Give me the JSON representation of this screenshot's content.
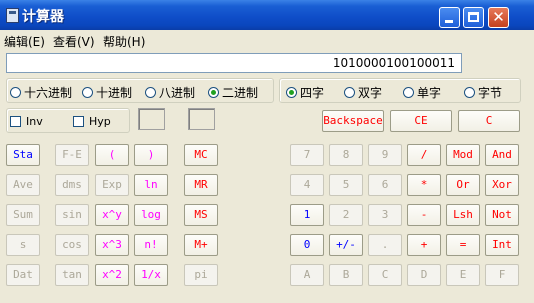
{
  "window": {
    "title": "计算器"
  },
  "menu": [
    "编辑(E)",
    "查看(V)",
    "帮助(H)"
  ],
  "display": {
    "value": "1010000100100011"
  },
  "base_options": [
    {
      "label": "十六进制",
      "selected": false
    },
    {
      "label": "十进制",
      "selected": false
    },
    {
      "label": "八进制",
      "selected": false
    },
    {
      "label": "二进制",
      "selected": true
    }
  ],
  "word_options": [
    {
      "label": "四字",
      "selected": true
    },
    {
      "label": "双字",
      "selected": false
    },
    {
      "label": "单字",
      "selected": false
    },
    {
      "label": "字节",
      "selected": false
    }
  ],
  "checkboxes": [
    {
      "label": "Inv",
      "checked": false
    },
    {
      "label": "Hyp",
      "checked": false
    }
  ],
  "clear_buttons": [
    "Backspace",
    "CE",
    "C"
  ],
  "buttons": {
    "col1": [
      "Sta",
      "Ave",
      "Sum",
      "s",
      "Dat"
    ],
    "col2": [
      "F-E",
      "dms",
      "sin",
      "cos",
      "tan"
    ],
    "col3": [
      "Exp",
      "x^y",
      "x^3",
      "x^2"
    ],
    "paren_open": "(",
    "paren_close": ")",
    "col4": [
      "ln",
      "log",
      "n!",
      "1/x"
    ],
    "memory": [
      "MC",
      "MR",
      "MS",
      "M+"
    ],
    "pi": "pi",
    "row1": [
      "7",
      "8",
      "9",
      "/",
      "Mod",
      "And"
    ],
    "row2": [
      "4",
      "5",
      "6",
      "*",
      "Or",
      "Xor"
    ],
    "row3": [
      "1",
      "2",
      "3",
      "-",
      "Lsh",
      "Not"
    ],
    "row4": [
      "0",
      "+/-",
      ".",
      "+",
      "=",
      "Int"
    ],
    "row5": [
      "A",
      "B",
      "C",
      "D",
      "E",
      "F"
    ]
  },
  "colors": {
    "blue": "#0000ff",
    "red": "#ff0000",
    "magenta": "#ff00ff",
    "disabled": "#aca899"
  }
}
